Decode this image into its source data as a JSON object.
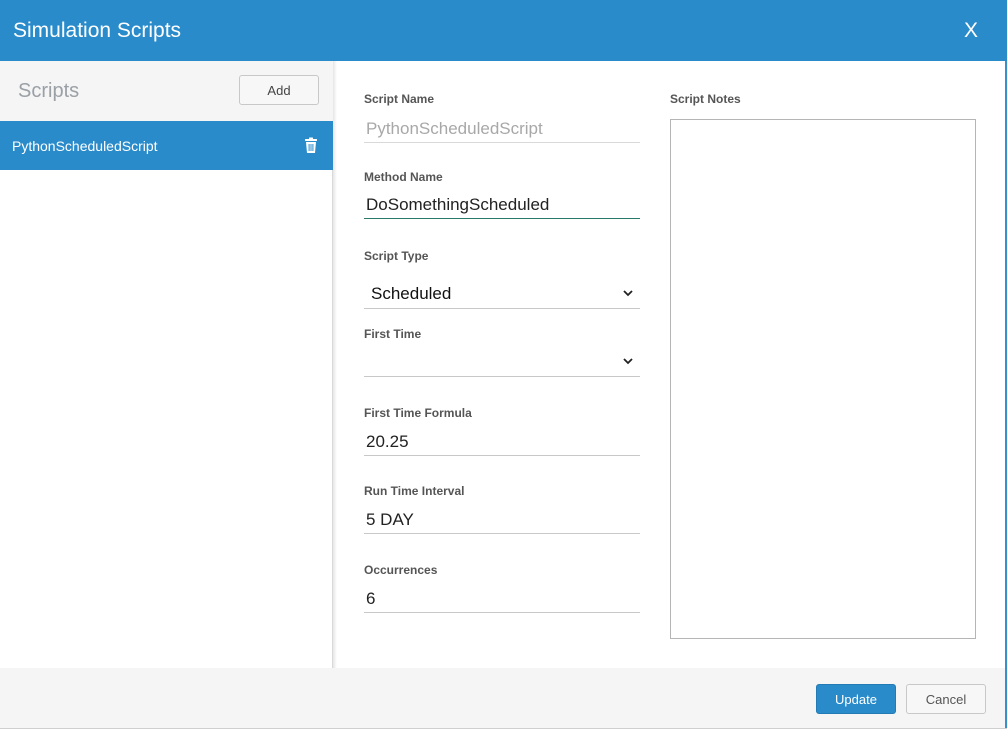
{
  "window": {
    "title": "Simulation Scripts",
    "close_label": "X"
  },
  "sidebar": {
    "heading": "Scripts",
    "add_label": "Add",
    "items": [
      {
        "label": "PythonScheduledScript",
        "selected": true,
        "icon": "trash-icon"
      }
    ]
  },
  "form": {
    "script_name": {
      "label": "Script Name",
      "value": "PythonScheduledScript",
      "readonly": true
    },
    "method_name": {
      "label": "Method Name",
      "value": "DoSomethingScheduled"
    },
    "script_type": {
      "label": "Script Type",
      "value": "Scheduled",
      "icon": "chevron-down-icon"
    },
    "first_time": {
      "label": "First Time",
      "value": "",
      "icon": "chevron-down-icon"
    },
    "first_time_formula": {
      "label": "First Time Formula",
      "value": "20.25"
    },
    "run_time_interval": {
      "label": "Run Time Interval",
      "value": "5 DAY"
    },
    "occurrences": {
      "label": "Occurrences",
      "value": "6"
    },
    "script_notes": {
      "label": "Script Notes",
      "value": ""
    }
  },
  "footer": {
    "update_label": "Update",
    "cancel_label": "Cancel"
  },
  "colors": {
    "accent": "#2a8bcb",
    "panel_bg": "#f5f5f5",
    "label": "#555555"
  }
}
